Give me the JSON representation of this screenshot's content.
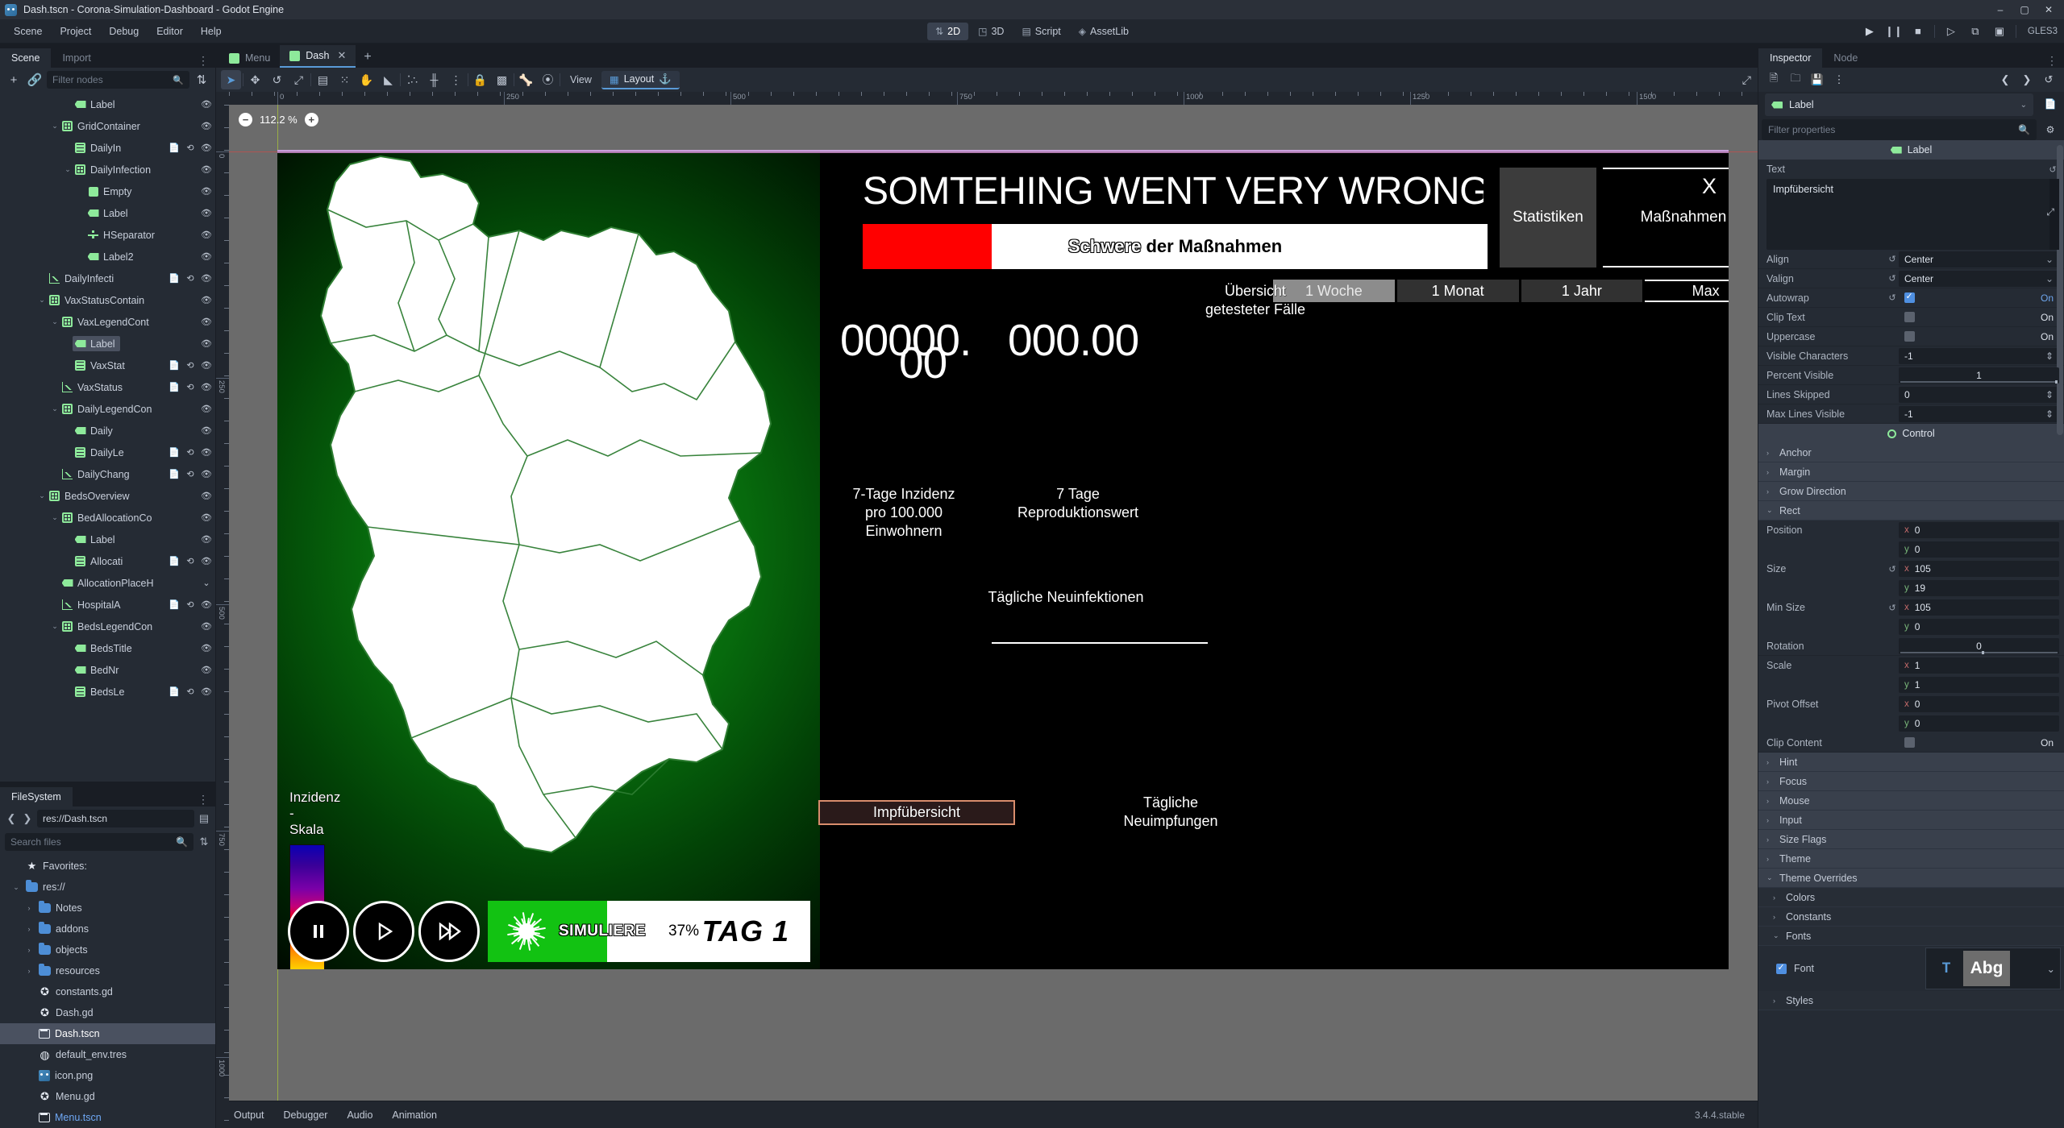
{
  "window": {
    "title": "Dash.tscn - Corona-Simulation-Dashboard - Godot Engine",
    "minimize": "–",
    "maximize": "▢",
    "close": "✕"
  },
  "menubar": {
    "items": [
      "Scene",
      "Project",
      "Debug",
      "Editor",
      "Help"
    ],
    "modes": [
      {
        "label": "2D",
        "icon": "move-2d-icon"
      },
      {
        "label": "3D",
        "icon": "cube-3d-icon"
      },
      {
        "label": "Script",
        "icon": "script-icon"
      },
      {
        "label": "AssetLib",
        "icon": "assetlib-icon"
      }
    ],
    "active_mode": "2D",
    "renderer": "GLES3",
    "right_icons": [
      "play-icon",
      "pause-icon",
      "stop-icon",
      "play-scene-icon",
      "remote-debug-icon",
      "movie-icon"
    ]
  },
  "left_dock": {
    "tabs": [
      "Scene",
      "Import"
    ],
    "active_tab": "Scene",
    "toolbar": {
      "add_node": "+",
      "instance": "link-icon",
      "filter_placeholder": "Filter nodes"
    },
    "tree": [
      {
        "depth": 4,
        "name": "Label",
        "icon": "label-icon",
        "twist": "",
        "tail": [
          "visibility"
        ],
        "selected": false
      },
      {
        "depth": 3,
        "name": "GridContainer",
        "icon": "grid-icon",
        "twist": "v",
        "tail": [
          "visibility"
        ],
        "selected": false
      },
      {
        "depth": 4,
        "name": "DailyIn",
        "icon": "vbox-icon",
        "twist": "",
        "tail": [
          "script",
          "signal",
          "visibility"
        ],
        "selected": false
      },
      {
        "depth": 4,
        "name": "DailyInfection",
        "icon": "grid-icon",
        "twist": "v",
        "tail": [
          "visibility"
        ],
        "selected": false
      },
      {
        "depth": 5,
        "name": "Empty",
        "icon": "rect-icon",
        "twist": "",
        "tail": [
          "visibility"
        ],
        "selected": false
      },
      {
        "depth": 5,
        "name": "Label",
        "icon": "label-icon",
        "twist": "",
        "tail": [
          "visibility"
        ],
        "selected": false
      },
      {
        "depth": 5,
        "name": "HSeparator",
        "icon": "sep-icon",
        "twist": "",
        "tail": [
          "visibility"
        ],
        "selected": false
      },
      {
        "depth": 5,
        "name": "Label2",
        "icon": "label-icon",
        "twist": "",
        "tail": [
          "visibility"
        ],
        "selected": false
      },
      {
        "depth": 2,
        "name": "DailyInfecti",
        "icon": "chart-icon",
        "twist": "",
        "tail": [
          "script",
          "signal",
          "visibility"
        ],
        "selected": false
      },
      {
        "depth": 2,
        "name": "VaxStatusContain",
        "icon": "grid-icon",
        "twist": "v",
        "tail": [
          "visibility"
        ],
        "selected": false
      },
      {
        "depth": 3,
        "name": "VaxLegendCont",
        "icon": "grid-icon",
        "twist": "v",
        "tail": [
          "visibility"
        ],
        "selected": false
      },
      {
        "depth": 4,
        "name": "Label",
        "icon": "label-icon",
        "twist": "",
        "tail": [
          "visibility"
        ],
        "selected": true
      },
      {
        "depth": 4,
        "name": "VaxStat",
        "icon": "vbox-icon",
        "twist": "",
        "tail": [
          "script",
          "signal",
          "visibility"
        ],
        "selected": false
      },
      {
        "depth": 3,
        "name": "VaxStatus",
        "icon": "chart-icon",
        "twist": "",
        "tail": [
          "script",
          "signal",
          "visibility"
        ],
        "selected": false
      },
      {
        "depth": 3,
        "name": "DailyLegendCon",
        "icon": "grid-icon",
        "twist": "v",
        "tail": [
          "visibility"
        ],
        "selected": false
      },
      {
        "depth": 4,
        "name": "Daily",
        "icon": "label-icon",
        "twist": "",
        "tail": [
          "visibility"
        ],
        "selected": false
      },
      {
        "depth": 4,
        "name": "DailyLe",
        "icon": "vbox-icon",
        "twist": "",
        "tail": [
          "script",
          "signal",
          "visibility"
        ],
        "selected": false
      },
      {
        "depth": 3,
        "name": "DailyChang",
        "icon": "chart-icon",
        "twist": "",
        "tail": [
          "script",
          "signal",
          "visibility"
        ],
        "selected": false
      },
      {
        "depth": 2,
        "name": "BedsOverview",
        "icon": "grid-icon",
        "twist": "v",
        "tail": [
          "visibility"
        ],
        "selected": false
      },
      {
        "depth": 3,
        "name": "BedAllocationCo",
        "icon": "grid-icon",
        "twist": "v",
        "tail": [
          "visibility"
        ],
        "selected": false
      },
      {
        "depth": 4,
        "name": "Label",
        "icon": "label-icon",
        "twist": "",
        "tail": [
          "visibility"
        ],
        "selected": false
      },
      {
        "depth": 4,
        "name": "Allocati",
        "icon": "vbox-icon",
        "twist": "",
        "tail": [
          "script",
          "signal",
          "visibility"
        ],
        "selected": false
      },
      {
        "depth": 3,
        "name": "AllocationPlaceH",
        "icon": "label-icon",
        "twist": "",
        "tail": [
          "expand"
        ],
        "selected": false
      },
      {
        "depth": 3,
        "name": "HospitalA",
        "icon": "chart-icon",
        "twist": "",
        "tail": [
          "script",
          "signal",
          "visibility"
        ],
        "selected": false
      },
      {
        "depth": 3,
        "name": "BedsLegendCon",
        "icon": "grid-icon",
        "twist": "v",
        "tail": [
          "visibility"
        ],
        "selected": false
      },
      {
        "depth": 4,
        "name": "BedsTitle",
        "icon": "label-icon",
        "twist": "",
        "tail": [
          "visibility"
        ],
        "selected": false
      },
      {
        "depth": 4,
        "name": "BedNr",
        "icon": "label-icon",
        "twist": "",
        "tail": [
          "visibility"
        ],
        "selected": false
      },
      {
        "depth": 4,
        "name": "BedsLe",
        "icon": "vbox-icon",
        "twist": "",
        "tail": [
          "script",
          "signal",
          "visibility"
        ],
        "selected": false
      }
    ]
  },
  "filesystem": {
    "tab": "FileSystem",
    "path": "res://Dash.tscn",
    "search_placeholder": "Search files",
    "items": [
      {
        "depth": 0,
        "name": "Favorites:",
        "icon": "star-icon",
        "twist": "",
        "selected": false,
        "link": false
      },
      {
        "depth": 0,
        "name": "res://",
        "icon": "folder-icon",
        "twist": "v",
        "selected": false,
        "link": false
      },
      {
        "depth": 1,
        "name": "Notes",
        "icon": "folder-icon",
        "twist": ">",
        "selected": false,
        "link": false
      },
      {
        "depth": 1,
        "name": "addons",
        "icon": "folder-icon",
        "twist": ">",
        "selected": false,
        "link": false
      },
      {
        "depth": 1,
        "name": "objects",
        "icon": "folder-icon",
        "twist": ">",
        "selected": false,
        "link": false
      },
      {
        "depth": 1,
        "name": "resources",
        "icon": "folder-icon",
        "twist": ">",
        "selected": false,
        "link": false
      },
      {
        "depth": 1,
        "name": "constants.gd",
        "icon": "gdscript-icon",
        "twist": "",
        "selected": false,
        "link": false
      },
      {
        "depth": 1,
        "name": "Dash.gd",
        "icon": "gdscript-icon",
        "twist": "",
        "selected": false,
        "link": false
      },
      {
        "depth": 1,
        "name": "Dash.tscn",
        "icon": "scene-icon",
        "twist": "",
        "selected": true,
        "link": false
      },
      {
        "depth": 1,
        "name": "default_env.tres",
        "icon": "resource-icon",
        "twist": "",
        "selected": false,
        "link": false
      },
      {
        "depth": 1,
        "name": "icon.png",
        "icon": "image-icon",
        "twist": "",
        "selected": false,
        "link": false
      },
      {
        "depth": 1,
        "name": "Menu.gd",
        "icon": "gdscript-icon",
        "twist": "",
        "selected": false,
        "link": false
      },
      {
        "depth": 1,
        "name": "Menu.tscn",
        "icon": "scene-icon",
        "twist": "",
        "selected": false,
        "link": true
      }
    ]
  },
  "center": {
    "scene_tabs": [
      {
        "label": "Menu",
        "active": false,
        "closable": false
      },
      {
        "label": "Dash",
        "active": true,
        "closable": true
      }
    ],
    "add_tab": "+",
    "toolbar": {
      "icons": [
        "select-icon",
        "move-icon",
        "rotate-icon",
        "scale-icon",
        "list-select-icon",
        "ruler-snap-icon",
        "pan-icon",
        "ruler-icon",
        "snap-icon",
        "smart-snap-icon",
        "snap-options-icon",
        "lock-icon",
        "group-icon",
        "bone-icon",
        "skeleton-icon"
      ],
      "view_label": "View",
      "layout_label": "Layout",
      "expand_icon": "expand-icon"
    },
    "zoom": "112.2 %",
    "zoom_out": "−",
    "zoom_in": "+",
    "ruler_labels": [
      "0",
      "250",
      "500",
      "750",
      "1000",
      "1250",
      "1500"
    ]
  },
  "game": {
    "title": "SOMTEHING WENT VERY WRONG",
    "severity_label_white": " der Maßnahmen",
    "severity_label_red": "Schwere",
    "tabs": [
      {
        "label": "Statistiken",
        "active": true
      },
      {
        "label": "Maßnahmen",
        "active": false
      }
    ],
    "close_x": "X",
    "ranges": [
      {
        "label": "1 Woche",
        "active": true
      },
      {
        "label": "1 Monat",
        "active": false
      },
      {
        "label": "1 Jahr",
        "active": false
      },
      {
        "label": "Max",
        "active": false
      }
    ],
    "overview_label": "Übersicht\ngetesteter Fälle",
    "big_number_1": "00000.",
    "big_number_1b": "00",
    "big_number_2": "000.00",
    "incidence_label": "7-Tage Inzidenz\npro 100.000\nEinwohnern",
    "reproduction_label": "7 Tage\nReproduktionswert",
    "daily_new_infections": "Tägliche Neuinfektionen",
    "vaccination_overview": "Impfübersicht",
    "daily_vaccinations": "Tägliche\nNeuimpfungen",
    "legend_title": "Inzidenz -\nSkala",
    "sim_controls": {
      "pause": "pause-icon",
      "play": "play-icon",
      "fast": "fast-forward-icon",
      "button_label": "SIMULIERE",
      "progress": "37%",
      "day": "TAG 1"
    }
  },
  "inspector": {
    "tabs": [
      "Inspector",
      "Node"
    ],
    "active_tab": "Inspector",
    "toolbar_icons": [
      "new-resource-icon",
      "load-icon",
      "save-icon",
      "tools-icon",
      "back-icon",
      "forward-icon",
      "history-icon"
    ],
    "node_type": "Label",
    "doc_icon": "open-docs-icon",
    "filter_placeholder": "Filter properties",
    "filter_tools_icon": "property-tools-icon",
    "category_label": "Label",
    "category_control": "Control",
    "properties": [
      {
        "kind": "text",
        "label": "Text",
        "value": "Impfübersicht",
        "revert": true
      },
      {
        "kind": "select",
        "label": "Align",
        "value": "Center",
        "revert": true
      },
      {
        "kind": "select",
        "label": "Valign",
        "value": "Center",
        "revert": true
      },
      {
        "kind": "check",
        "label": "Autowrap",
        "value": "On",
        "checked": true,
        "revert": true
      },
      {
        "kind": "check",
        "label": "Clip Text",
        "value": "On",
        "checked": false,
        "revert": false
      },
      {
        "kind": "check",
        "label": "Uppercase",
        "value": "On",
        "checked": false,
        "revert": false
      },
      {
        "kind": "spin",
        "label": "Visible Characters",
        "value": "-1",
        "revert": false
      },
      {
        "kind": "slider",
        "label": "Percent Visible",
        "value": "1",
        "revert": false
      },
      {
        "kind": "spin",
        "label": "Lines Skipped",
        "value": "0",
        "revert": false
      },
      {
        "kind": "spin",
        "label": "Max Lines Visible",
        "value": "-1",
        "revert": false
      }
    ],
    "control_sections": [
      "Anchor",
      "Margin",
      "Grow Direction"
    ],
    "rect_label": "Rect",
    "rect": [
      {
        "label": "Position",
        "x": "0",
        "y": "0",
        "revert": false
      },
      {
        "label": "Size",
        "x": "105",
        "y": "19",
        "revert": true
      },
      {
        "label": "Min Size",
        "x": "105",
        "y": "0",
        "revert": true
      }
    ],
    "rotation": {
      "label": "Rotation",
      "value": "0"
    },
    "scale": {
      "label": "Scale",
      "x": "1",
      "y": "1"
    },
    "pivot": {
      "label": "Pivot Offset",
      "x": "0",
      "y": "0"
    },
    "clip_content": {
      "label": "Clip Content",
      "value": "On",
      "checked": false
    },
    "sections": [
      "Hint",
      "Focus",
      "Mouse",
      "Input",
      "Size Flags",
      "Theme"
    ],
    "theme_overrides": "Theme Overrides",
    "theme_children": [
      "Colors",
      "Constants"
    ],
    "fonts_label": "Fonts",
    "font": {
      "label": "Font",
      "checked": true,
      "preview": "Abg",
      "icon": "font-icon"
    },
    "styles_label": "Styles"
  },
  "bottom_panel": {
    "items": [
      "Output",
      "Debugger",
      "Audio",
      "Animation"
    ],
    "version": "3.4.4.stable"
  }
}
